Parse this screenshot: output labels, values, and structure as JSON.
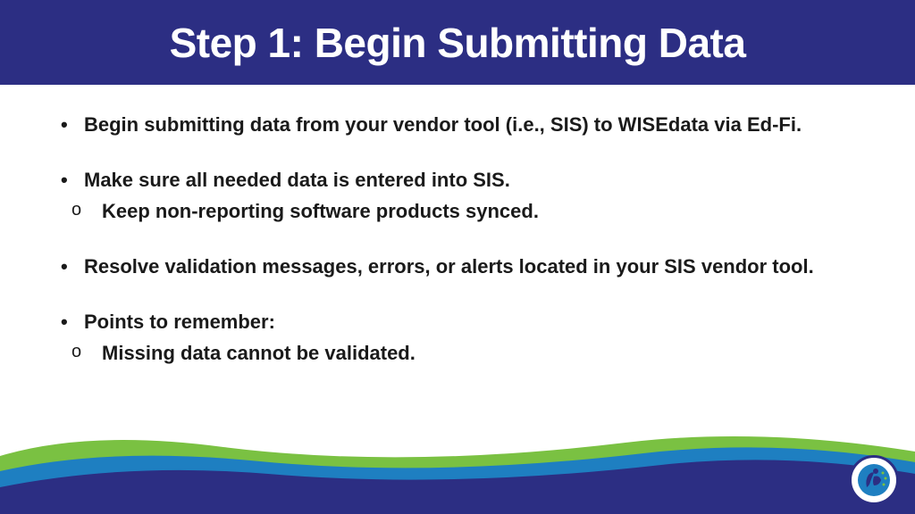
{
  "header": {
    "title": "Step 1:  Begin Submitting Data"
  },
  "bullets": [
    {
      "text": "Begin submitting data from your vendor tool (i.e., SIS) to WISEdata via Ed-Fi.",
      "subs": []
    },
    {
      "text": "Make sure all needed data is entered into SIS.",
      "subs": [
        "Keep non-reporting software products synced."
      ]
    },
    {
      "text": "Resolve validation messages, errors,  or alerts located in your SIS vendor tool.",
      "subs": []
    },
    {
      "text": "Points to remember:",
      "subs": [
        "Missing data cannot be validated."
      ]
    }
  ],
  "colors": {
    "headerBg": "#2c2e83",
    "waveGreen": "#7ac142",
    "waveBlue": "#1e7fc1",
    "waveNavy": "#2c2e83"
  }
}
